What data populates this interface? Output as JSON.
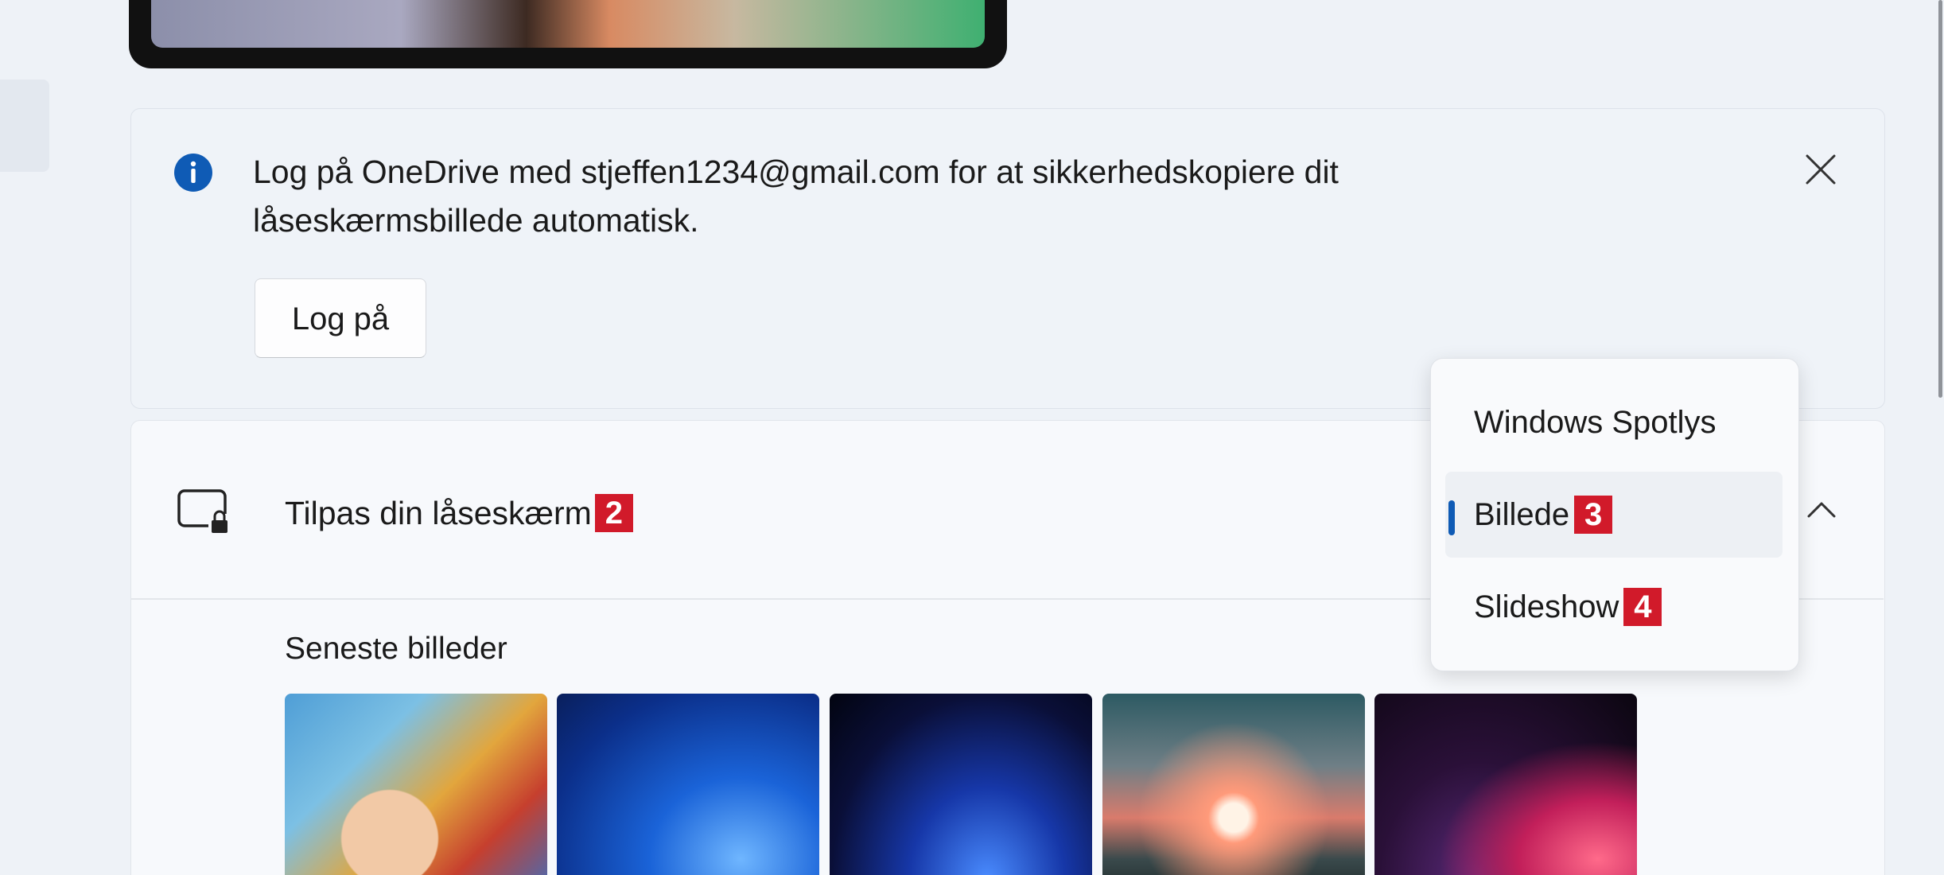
{
  "infobar": {
    "message_line1": "Log på OneDrive med stjeffen1234@gmail.com for at sikkerhedskopiere dit",
    "message_line2": "låseskærmsbillede automatisk.",
    "signin_label": "Log på",
    "accent_color": "#0f5bb5"
  },
  "lockscreen": {
    "title": "Tilpas din låseskærm",
    "title_badge": "2",
    "recent_label": "Seneste billeder",
    "thumbnails": [
      {
        "name": "baby-photo"
      },
      {
        "name": "blue-bloom-light"
      },
      {
        "name": "blue-bloom-dark"
      },
      {
        "name": "sunset-lake"
      },
      {
        "name": "purple-ribbon"
      }
    ]
  },
  "dropdown": {
    "options": [
      {
        "label": "Windows Spotlys",
        "badge": ""
      },
      {
        "label": "Billede",
        "badge": "3"
      },
      {
        "label": "Slideshow",
        "badge": "4"
      }
    ],
    "selected_index": 1
  },
  "colors": {
    "badge": "#d11a2a",
    "selection_indicator": "#0f5bb5"
  }
}
